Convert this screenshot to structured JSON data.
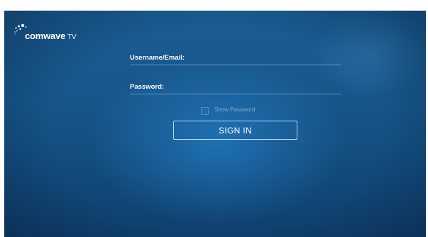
{
  "brand": {
    "name": "comwave",
    "suffix": "TV",
    "logo_icon": "comwave-dots-logo-icon"
  },
  "form": {
    "username_label": "Username/Email:",
    "username_value": "",
    "password_label": "Password:",
    "password_value": "",
    "show_password_label": "Show Password",
    "show_password_checked": false,
    "signin_label": "SIGN IN"
  },
  "colors": {
    "background": "#17568b",
    "text": "#ffffff",
    "muted_text": "#b9cde1"
  }
}
